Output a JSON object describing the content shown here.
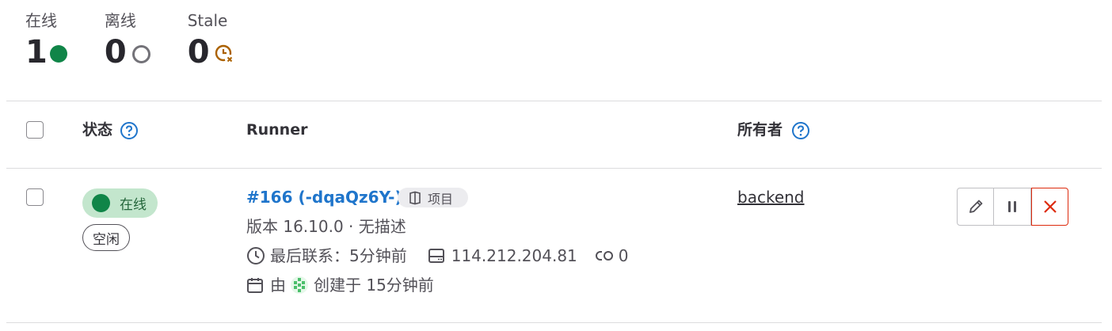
{
  "stats": {
    "online": {
      "label": "在线",
      "count": "1"
    },
    "offline": {
      "label": "离线",
      "count": "0"
    },
    "stale": {
      "label": "Stale",
      "count": "0"
    }
  },
  "table": {
    "headers": {
      "status": "状态",
      "runner": "Runner",
      "owner": "所有者"
    }
  },
  "row": {
    "status_badge": "在线",
    "idle_badge": "空闲",
    "runner_id": "#166 (-dqaQz6Y-)",
    "type_badge": "项目",
    "version_line": "版本 16.10.0 · 无描述",
    "last_contact": "最后联系：5分钟前",
    "ip": "114.212.204.81",
    "jobs": "0",
    "created_prefix": "由",
    "created_suffix": "创建于 15分钟前",
    "owner": "backend"
  },
  "colors": {
    "online": "#108548",
    "offline": "#737278",
    "stale": "#ab6100",
    "link": "#1f75cb",
    "danger": "#dd2b0e"
  },
  "icons": [
    "status-online-dot",
    "status-offline-dot",
    "stale-clock-icon",
    "question-circle-icon",
    "project-icon",
    "clock-icon",
    "ip-machine-icon",
    "jobs-link-icon",
    "calendar-icon",
    "user-avatar-icon",
    "pencil-icon",
    "pause-icon",
    "close-icon"
  ]
}
